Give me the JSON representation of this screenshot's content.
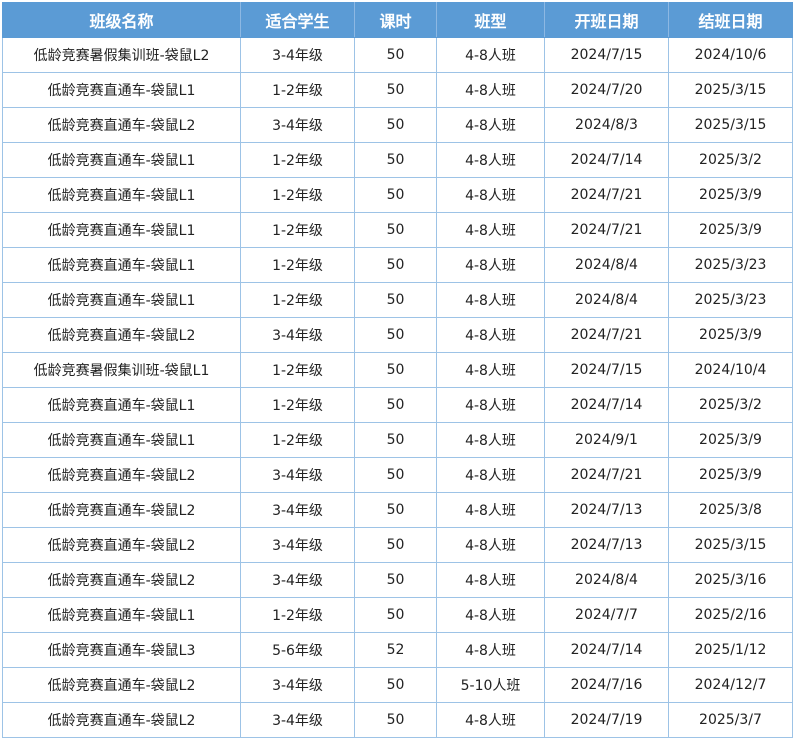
{
  "table": {
    "headers": [
      "班级名称",
      "适合学生",
      "课时",
      "班型",
      "开班日期",
      "结班日期"
    ],
    "rows": [
      [
        "低龄竞赛暑假集训班-袋鼠L2",
        "3-4年级",
        "50",
        "4-8人班",
        "2024/7/15",
        "2024/10/6"
      ],
      [
        "低龄竞赛直通车-袋鼠L1",
        "1-2年级",
        "50",
        "4-8人班",
        "2024/7/20",
        "2025/3/15"
      ],
      [
        "低龄竞赛直通车-袋鼠L2",
        "3-4年级",
        "50",
        "4-8人班",
        "2024/8/3",
        "2025/3/15"
      ],
      [
        "低龄竞赛直通车-袋鼠L1",
        "1-2年级",
        "50",
        "4-8人班",
        "2024/7/14",
        "2025/3/2"
      ],
      [
        "低龄竞赛直通车-袋鼠L1",
        "1-2年级",
        "50",
        "4-8人班",
        "2024/7/21",
        "2025/3/9"
      ],
      [
        "低龄竞赛直通车-袋鼠L1",
        "1-2年级",
        "50",
        "4-8人班",
        "2024/7/21",
        "2025/3/9"
      ],
      [
        "低龄竞赛直通车-袋鼠L1",
        "1-2年级",
        "50",
        "4-8人班",
        "2024/8/4",
        "2025/3/23"
      ],
      [
        "低龄竞赛直通车-袋鼠L1",
        "1-2年级",
        "50",
        "4-8人班",
        "2024/8/4",
        "2025/3/23"
      ],
      [
        "低龄竞赛直通车-袋鼠L2",
        "3-4年级",
        "50",
        "4-8人班",
        "2024/7/21",
        "2025/3/9"
      ],
      [
        "低龄竞赛暑假集训班-袋鼠L1",
        "1-2年级",
        "50",
        "4-8人班",
        "2024/7/15",
        "2024/10/4"
      ],
      [
        "低龄竞赛直通车-袋鼠L1",
        "1-2年级",
        "50",
        "4-8人班",
        "2024/7/14",
        "2025/3/2"
      ],
      [
        "低龄竞赛直通车-袋鼠L1",
        "1-2年级",
        "50",
        "4-8人班",
        "2024/9/1",
        "2025/3/9"
      ],
      [
        "低龄竞赛直通车-袋鼠L2",
        "3-4年级",
        "50",
        "4-8人班",
        "2024/7/21",
        "2025/3/9"
      ],
      [
        "低龄竞赛直通车-袋鼠L2",
        "3-4年级",
        "50",
        "4-8人班",
        "2024/7/13",
        "2025/3/8"
      ],
      [
        "低龄竞赛直通车-袋鼠L2",
        "3-4年级",
        "50",
        "4-8人班",
        "2024/7/13",
        "2025/3/15"
      ],
      [
        "低龄竞赛直通车-袋鼠L2",
        "3-4年级",
        "50",
        "4-8人班",
        "2024/8/4",
        "2025/3/16"
      ],
      [
        "低龄竞赛直通车-袋鼠L1",
        "1-2年级",
        "50",
        "4-8人班",
        "2024/7/7",
        "2025/2/16"
      ],
      [
        "低龄竞赛直通车-袋鼠L3",
        "5-6年级",
        "52",
        "4-8人班",
        "2024/7/14",
        "2025/1/12"
      ],
      [
        "低龄竞赛直通车-袋鼠L2",
        "3-4年级",
        "50",
        "5-10人班",
        "2024/7/16",
        "2024/12/7"
      ],
      [
        "低龄竞赛直通车-袋鼠L2",
        "3-4年级",
        "50",
        "4-8人班",
        "2024/7/19",
        "2025/3/7"
      ]
    ]
  }
}
